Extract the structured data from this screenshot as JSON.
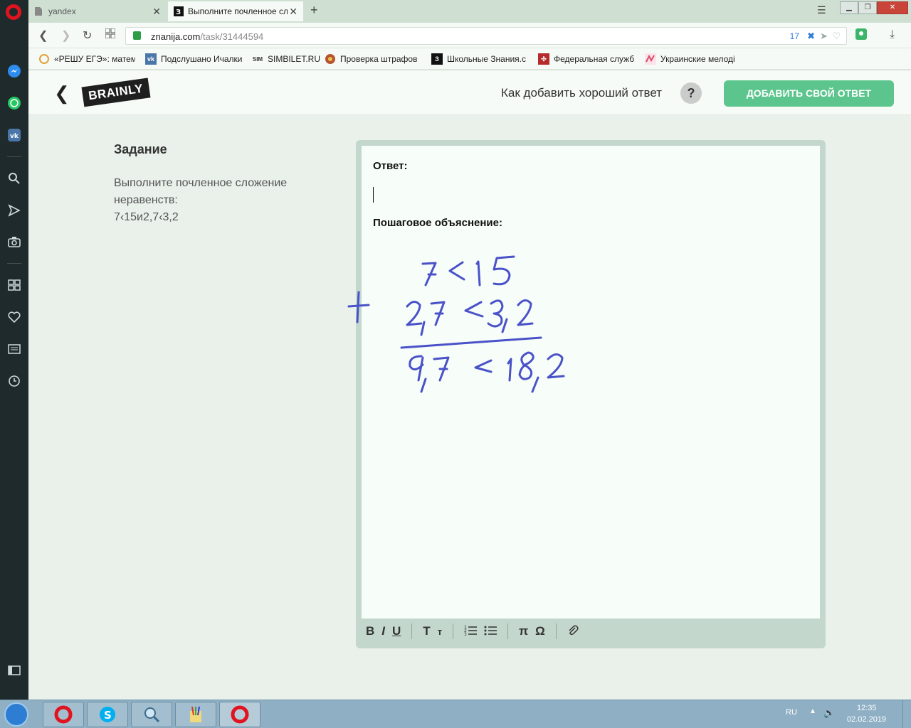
{
  "browser": {
    "tabs": [
      {
        "label": "yandex",
        "active": false
      },
      {
        "label": "Выполните почленное сл",
        "active": true
      }
    ],
    "url": {
      "domain": "znanija.com",
      "path": "/task/31444594",
      "counter": "17"
    },
    "bookmarks": [
      {
        "label": "«РЕШУ ЕГЭ»: матема",
        "icon": "sun-icon",
        "color": "#e0a23a"
      },
      {
        "label": "Подслушано Ичалки",
        "icon": "vk-icon",
        "color": "#4a76a8"
      },
      {
        "label": "SIMBILET.RU",
        "icon": "sim-icon",
        "color": "#444444"
      },
      {
        "label": "Проверка штрафов",
        "icon": "emblem-icon",
        "color": "#b8532f"
      },
      {
        "label": "Школьные Знания.с",
        "icon": "znanija-icon",
        "color": "#111111"
      },
      {
        "label": "Федеральная служб",
        "icon": "fns-icon",
        "color": "#b52a2a"
      },
      {
        "label": "Украинские мелоді",
        "icon": "wave-icon",
        "color": "#d94a6a"
      }
    ]
  },
  "header": {
    "brand": "BRAINLY",
    "howto": "Как добавить хороший ответ",
    "help": "?",
    "add_answer": "ДОБАВИТЬ СВОЙ ОТВЕТ"
  },
  "task": {
    "title": "Задание",
    "text_line1": "Выполните почленное сложение",
    "text_line2": "неравенств:",
    "text_line3": "7‹15и2,7‹3,2"
  },
  "editor": {
    "answer_label": "Ответ:",
    "explanation_label": "Пошаговое объяснение:",
    "handwriting": {
      "line1": "7 < 15",
      "line2": "2,7 < 3,2",
      "result": "9,7 < 18,2",
      "operator": "+",
      "color": "#4a52c9"
    },
    "toolbar": [
      "B",
      "I",
      "U",
      "T",
      "т",
      "ordered-list",
      "bullet-list",
      "π",
      "Ω",
      "attach"
    ]
  },
  "taskbar": {
    "lang": "RU",
    "time": "12:35",
    "date": "02.02.2019"
  }
}
